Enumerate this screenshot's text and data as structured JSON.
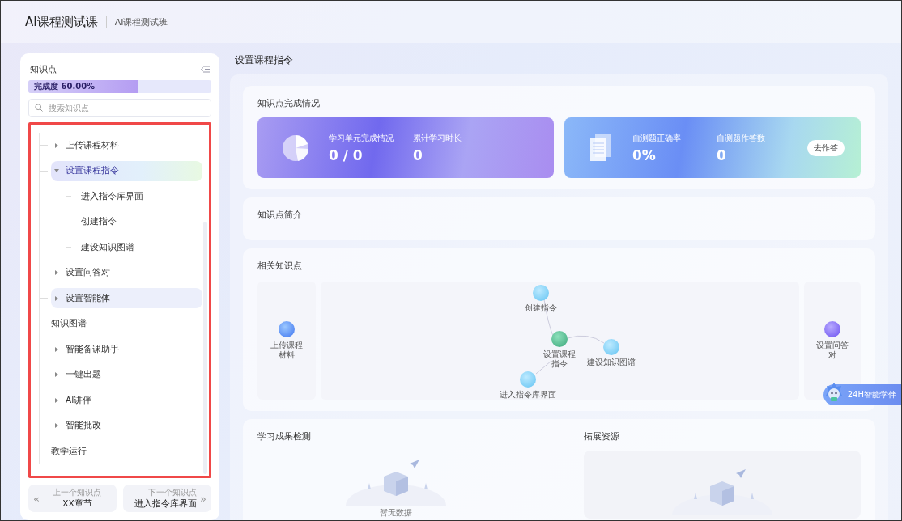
{
  "header": {
    "title": "AI课程测试课",
    "subtitle": "AI课程测试班"
  },
  "sidebar": {
    "title": "知识点",
    "progress": {
      "label": "完成度 60.00%",
      "level": 0.6
    },
    "search": {
      "placeholder": "搜索知识点"
    },
    "tree": [
      {
        "label": "上传课程材料",
        "expandable": true,
        "expanded": false,
        "selected": false,
        "hovered": false
      },
      {
        "label": "设置课程指令",
        "expandable": true,
        "expanded": true,
        "selected": true,
        "hovered": false,
        "children": [
          {
            "label": "进入指令库界面"
          },
          {
            "label": "创建指令"
          },
          {
            "label": "建设知识图谱"
          }
        ]
      },
      {
        "label": "设置问答对",
        "expandable": true,
        "expanded": false,
        "selected": false,
        "hovered": false
      },
      {
        "label": "设置智能体",
        "expandable": true,
        "expanded": false,
        "selected": false,
        "hovered": true
      },
      {
        "label": "知识图谱",
        "expandable": false,
        "expanded": false,
        "selected": false,
        "hovered": false
      },
      {
        "label": "智能备课助手",
        "expandable": true,
        "expanded": false,
        "selected": false,
        "hovered": false
      },
      {
        "label": "一键出题",
        "expandable": true,
        "expanded": false,
        "selected": false,
        "hovered": false
      },
      {
        "label": "AI讲伴",
        "expandable": true,
        "expanded": false,
        "selected": false,
        "hovered": false
      },
      {
        "label": "智能批改",
        "expandable": true,
        "expanded": false,
        "selected": false,
        "hovered": false
      },
      {
        "label": "教学运行",
        "expandable": false,
        "expanded": false,
        "selected": false,
        "hovered": false
      }
    ],
    "prev": {
      "icon": "«",
      "caption": "上一个知识点",
      "value": "XX章节"
    },
    "next": {
      "icon": "»",
      "caption": "下一个知识点",
      "value": "进入指令库界面"
    }
  },
  "main": {
    "title": "设置课程指令",
    "completion": {
      "title": "知识点完成情况",
      "cards": [
        {
          "kind": "study",
          "stats": [
            {
              "label": "学习单元完成情况",
              "value": "0 / 0"
            },
            {
              "label": "累计学习时长",
              "value": "0"
            }
          ]
        },
        {
          "kind": "quiz",
          "stats": [
            {
              "label": "自测题正确率",
              "value": "0%"
            },
            {
              "label": "自测题作答数",
              "value": "0"
            }
          ],
          "action": "去作答"
        }
      ]
    },
    "intro": {
      "title": "知识点简介"
    },
    "related": {
      "title": "相关知识点",
      "prev": {
        "label": "上传课程材料",
        "kind": "prev"
      },
      "next": {
        "label": "设置问答对",
        "kind": "next"
      },
      "nodes": [
        {
          "label": "创建指令",
          "kind": "related"
        },
        {
          "label": "设置课程指令",
          "kind": "current"
        },
        {
          "label": "建设知识图谱",
          "kind": "related"
        },
        {
          "label": "进入指令库界面",
          "kind": "related"
        }
      ]
    },
    "results": {
      "title": "学习成果检测",
      "empty": "暂无数据"
    },
    "resources": {
      "title": "拓展资源"
    }
  },
  "assistant": {
    "label": "24H智能学伴"
  }
}
